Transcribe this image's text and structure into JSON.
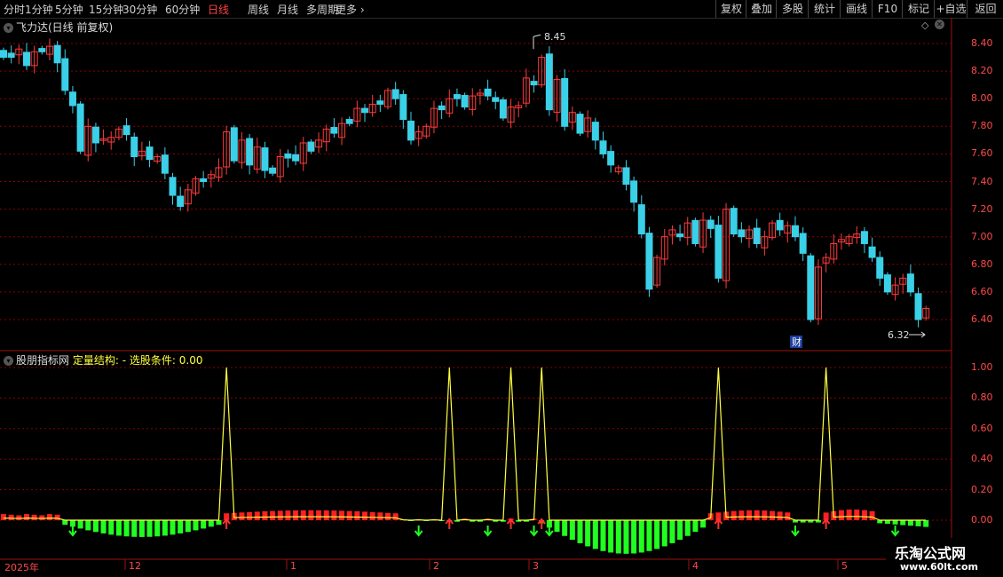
{
  "toolbar": {
    "periods": [
      "分时",
      "1分钟",
      "5分钟",
      "15分钟",
      "30分钟",
      "60分钟",
      "日线",
      "周线",
      "月线",
      "多周期",
      "更多"
    ],
    "active_period": "日线",
    "right_buttons": [
      "复权",
      "叠加",
      "多股",
      "统计",
      "画线",
      "F10",
      "标记",
      "+自选",
      "返回"
    ]
  },
  "main_panel": {
    "title": "飞力达(日线 前复权)",
    "high_marker": "8.45",
    "low_marker": "6.32",
    "event_badge": "财",
    "price_ticks": [
      "8.40",
      "8.20",
      "8.00",
      "7.80",
      "7.60",
      "7.40",
      "7.20",
      "7.00",
      "6.80",
      "6.60",
      "6.40"
    ]
  },
  "indicator_panel": {
    "name": "股朋指标网",
    "indicator": "定量结构: -",
    "condition_label": "选股条件:",
    "condition_value": "0.00",
    "ticks": [
      "1.00",
      "0.80",
      "0.60",
      "0.40",
      "0.20",
      "0.00"
    ]
  },
  "date_axis": [
    "2025年",
    "12",
    "1",
    "2",
    "3",
    "4",
    "5"
  ],
  "logo": {
    "main": "乐淘公式网",
    "sub": "www.60lt.com"
  },
  "colors": {
    "up": "#ff3b3b",
    "down": "#3ad0e8",
    "bar_pos": "#ff2020",
    "bar_neg": "#20ff20",
    "signal": "#ffff40",
    "grid": "#8b0000"
  },
  "chart_data": [
    {
      "type": "candlestick",
      "title": "飞力达(日线 前复权)",
      "y_range": [
        6.32,
        8.45
      ],
      "y_ticks": [
        8.4,
        8.2,
        8.0,
        7.8,
        7.6,
        7.4,
        7.2,
        7.0,
        6.8,
        6.6,
        6.4
      ],
      "highest": 8.45,
      "lowest": 6.32,
      "closes": [
        8.3,
        8.3,
        8.36,
        8.24,
        8.34,
        8.34,
        8.38,
        8.26,
        8.06,
        7.95,
        7.62,
        7.8,
        7.68,
        7.71,
        7.72,
        7.78,
        7.74,
        7.58,
        7.62,
        7.56,
        7.58,
        7.46,
        7.3,
        7.22,
        7.34,
        7.42,
        7.4,
        7.45,
        7.5,
        7.76,
        7.55,
        7.7,
        7.52,
        7.65,
        7.48,
        7.46,
        7.58,
        7.57,
        7.55,
        7.68,
        7.62,
        7.7,
        7.78,
        7.75,
        7.82,
        7.82,
        7.93,
        7.9,
        7.96,
        7.96,
        8.06,
        8.0,
        7.85,
        7.7,
        7.76,
        7.8,
        7.93,
        7.92,
        8.0,
        8.0,
        7.94,
        8.02,
        8.04,
        8.02,
        7.98,
        7.86,
        7.94,
        7.95,
        8.15,
        8.1,
        8.3,
        7.92,
        8.14,
        7.8,
        7.9,
        7.75,
        7.86,
        7.7,
        7.6,
        7.52,
        7.5,
        7.38,
        7.25,
        7.02,
        6.62,
        6.85,
        7.0,
        7.05,
        7.0,
        7.1,
        6.95,
        7.12,
        7.06,
        6.7,
        7.2,
        7.02,
        7.0,
        7.05,
        6.95,
        7.0,
        7.1,
        7.05,
        7.08,
        7.0,
        6.88,
        6.4,
        6.78,
        6.85,
        6.95,
        6.98,
        7.0,
        7.02,
        6.95,
        6.85,
        6.7,
        6.6,
        6.65,
        6.7,
        6.6,
        6.4,
        6.48
      ]
    },
    {
      "type": "bar",
      "title": "定量结构",
      "y_range": [
        0,
        1
      ],
      "y_ticks": [
        1.0,
        0.8,
        0.6,
        0.4,
        0.2,
        0.0
      ],
      "signal_peaks": [
        1,
        1,
        1,
        1,
        1,
        1
      ],
      "up_arrow_count": 6,
      "down_arrow_count": 7
    }
  ]
}
